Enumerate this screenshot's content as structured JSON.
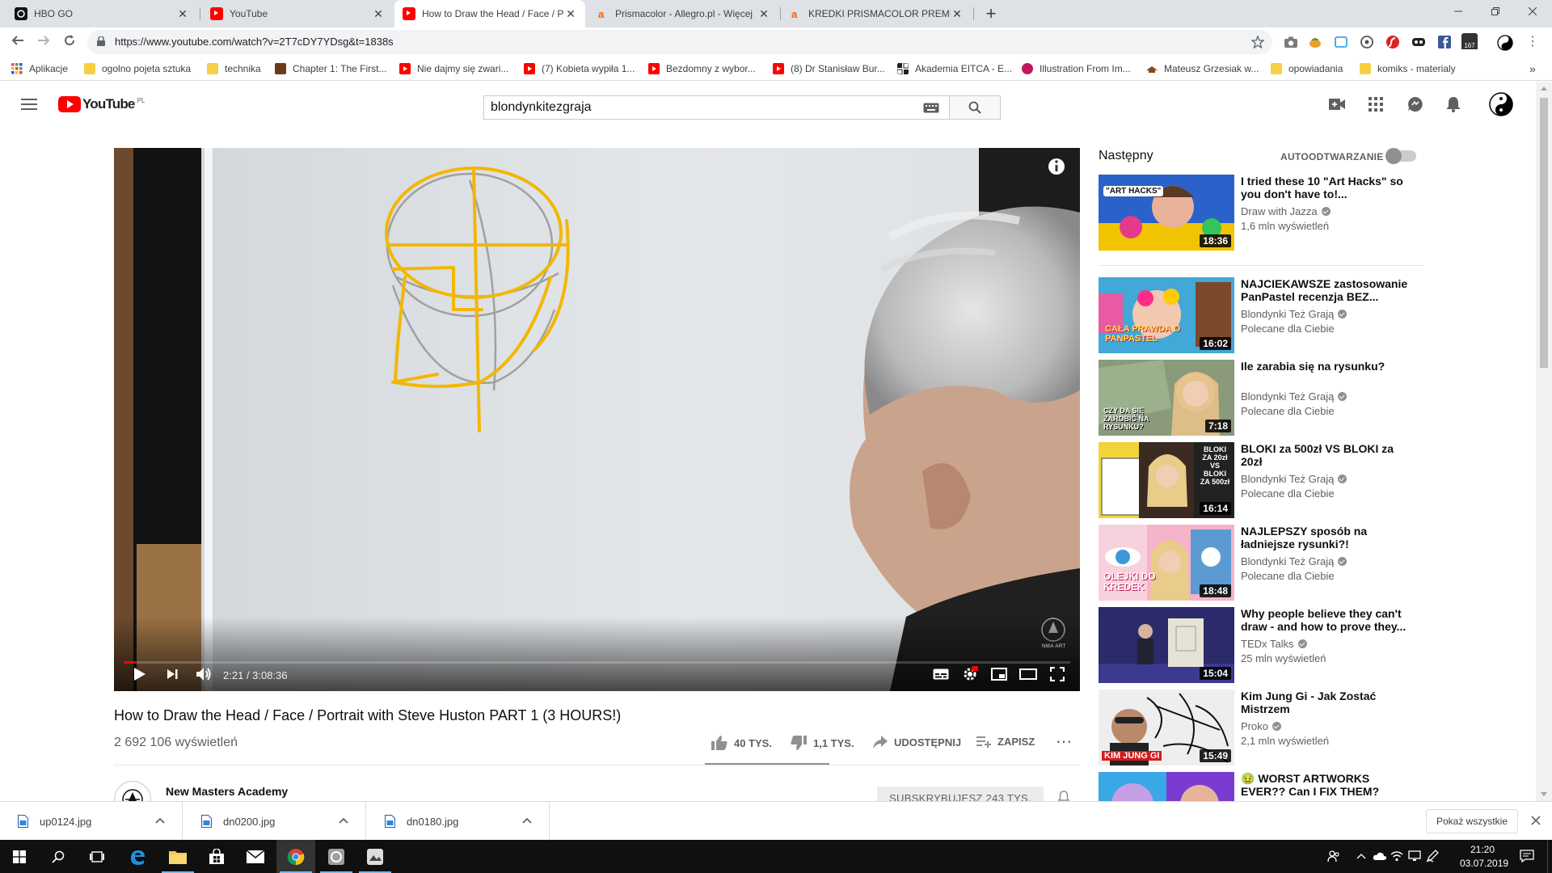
{
  "browser": {
    "tabs": [
      {
        "title": "HBO GO",
        "icon": "hbo-icon"
      },
      {
        "title": "YouTube",
        "icon": "youtube-icon"
      },
      {
        "title": "How to Draw the Head / Face / P",
        "icon": "youtube-icon",
        "active": true
      },
      {
        "title": "Prismacolor - Allegro.pl - Więcej",
        "icon": "allegro-icon"
      },
      {
        "title": "KREDKI PRISMACOLOR PREMIER",
        "icon": "allegro-icon"
      }
    ],
    "new_tab": "+",
    "url": "https://www.youtube.com/watch?v=2T7cDY7YDsg&t=1838s",
    "bookmarks": [
      {
        "label": "Aplikacje",
        "icon": "apps-grid-icon"
      },
      {
        "label": "ogolno pojeta sztuka",
        "icon": "folder-icon"
      },
      {
        "label": "technika",
        "icon": "folder-icon"
      },
      {
        "label": "Chapter 1: The First...",
        "icon": "book-icon"
      },
      {
        "label": "Nie dajmy się zwari...",
        "icon": "youtube-icon"
      },
      {
        "label": "(7) Kobieta wypiła 1...",
        "icon": "youtube-icon"
      },
      {
        "label": "Bezdomny z wybor...",
        "icon": "youtube-icon"
      },
      {
        "label": "(8) Dr Stanisław Bur...",
        "icon": "youtube-icon"
      },
      {
        "label": "Akademia EITCA - E...",
        "icon": "eitca-icon"
      },
      {
        "label": "Illustration From Im...",
        "icon": "illustration-icon"
      },
      {
        "label": "Mateusz Grzesiak w...",
        "icon": "hat-icon"
      },
      {
        "label": "opowiadania",
        "icon": "folder-icon"
      },
      {
        "label": "komiks - materialy",
        "icon": "folder-icon"
      }
    ],
    "bookmarks_more": "»",
    "ext_badge": "167"
  },
  "youtube": {
    "logo_text": "YouTube",
    "logo_region": "PL",
    "search_value": "blondynkitezgraja"
  },
  "video": {
    "current_time": "2:21",
    "duration": "3:08:36",
    "time_display": "2:21 / 3:08:36",
    "progress_fraction": 0.0125,
    "title": "How to Draw the Head / Face / Portrait with Steve Huston PART 1 (3 HOURS!)",
    "views": "2 692 106 wyświetleń",
    "likes": "40 TYS.",
    "dislikes": "1,1 TYS.",
    "share": "UDOSTĘPNIJ",
    "save": "ZAPISZ",
    "watermark": "NMA ART",
    "channel": "New Masters Academy",
    "subscribe": "SUBSKRYBUJESZ 243 TYS."
  },
  "sidebar": {
    "next_label": "Następny",
    "autoplay_label": "AUTOODTWARZANIE",
    "recommendations": [
      {
        "title": "I tried these 10 \"Art Hacks\" so you don't have to!...",
        "channel": "Draw with Jazza",
        "meta": "1,6 mln wyświetleń",
        "duration": "18:36",
        "thumb_text": "\"ART HACKS\"",
        "color1": "#2a62c9",
        "color2": "#f2c300"
      },
      {
        "title": "NAJCIEKAWSZE zastosowanie PanPastel recenzja BEZ...",
        "channel": "Blondynki Też Grają",
        "meta": "Polecane dla Ciebie",
        "duration": "16:02",
        "thumb_text": "CAŁA PRAWDA O PANPASTEL",
        "color1": "#e85aa1",
        "color2": "#41a8d8"
      },
      {
        "title": "Ile zarabia się na rysunku?",
        "channel": "Blondynki Też Grają",
        "meta": "Polecane dla Ciebie",
        "duration": "7:18",
        "thumb_text": "CZY DA SIĘ ZAROBIĆ NA RYSUNKU?",
        "color1": "#7d8f6a",
        "color2": "#c9a27a"
      },
      {
        "title": "BLOKI za 500zł VS BLOKI za 20zł",
        "channel": "Blondynki Też Grają",
        "meta": "Polecane dla Ciebie",
        "duration": "16:14",
        "thumb_text": "BLOKI ZA 20zł VS BLOKI ZA 500zł",
        "color1": "#f2d43a",
        "color2": "#2b2b2b"
      },
      {
        "title": "NAJLEPSZY sposób na ładniejsze rysunki?!",
        "channel": "Blondynki Też Grają",
        "meta": "Polecane dla Ciebie",
        "duration": "18:48",
        "thumb_text": "OLEJKI DO KREDEK",
        "color1": "#f4b3c8",
        "color2": "#5b9bd1"
      },
      {
        "title": "Why people believe they can't draw - and how to prove they...",
        "channel": "TEDx Talks",
        "meta": "25 mln wyświetleń",
        "duration": "15:04",
        "thumb_text": "",
        "color1": "#3c3a8e",
        "color2": "#d9d6cc"
      },
      {
        "title": "Kim Jung Gi - Jak Zostać Mistrzem",
        "channel": "Proko",
        "meta": "2,1 mln wyświetleń",
        "duration": "15:49",
        "thumb_text": "KIM JUNG GI",
        "color1": "#eeeeee",
        "color2": "#d21c1c"
      },
      {
        "title": "🤢 WORST ARTWORKS EVER?? Can I FIX THEM?",
        "channel": "",
        "meta": "",
        "duration": "",
        "thumb_text": "",
        "color1": "#7a3bd1",
        "color2": "#3aa7e6"
      }
    ]
  },
  "downloads": [
    {
      "file": "up0124.jpg"
    },
    {
      "file": "dn0200.jpg"
    },
    {
      "file": "dn0180.jpg"
    }
  ],
  "downloads_show_all": "Pokaż wszystkie",
  "taskbar": {
    "time": "21:20",
    "date": "03.07.2019"
  },
  "colors": {
    "youtube_red": "#ff0000",
    "chrome_tabstrip": "#dee1e6",
    "taskbar": "#101010"
  }
}
